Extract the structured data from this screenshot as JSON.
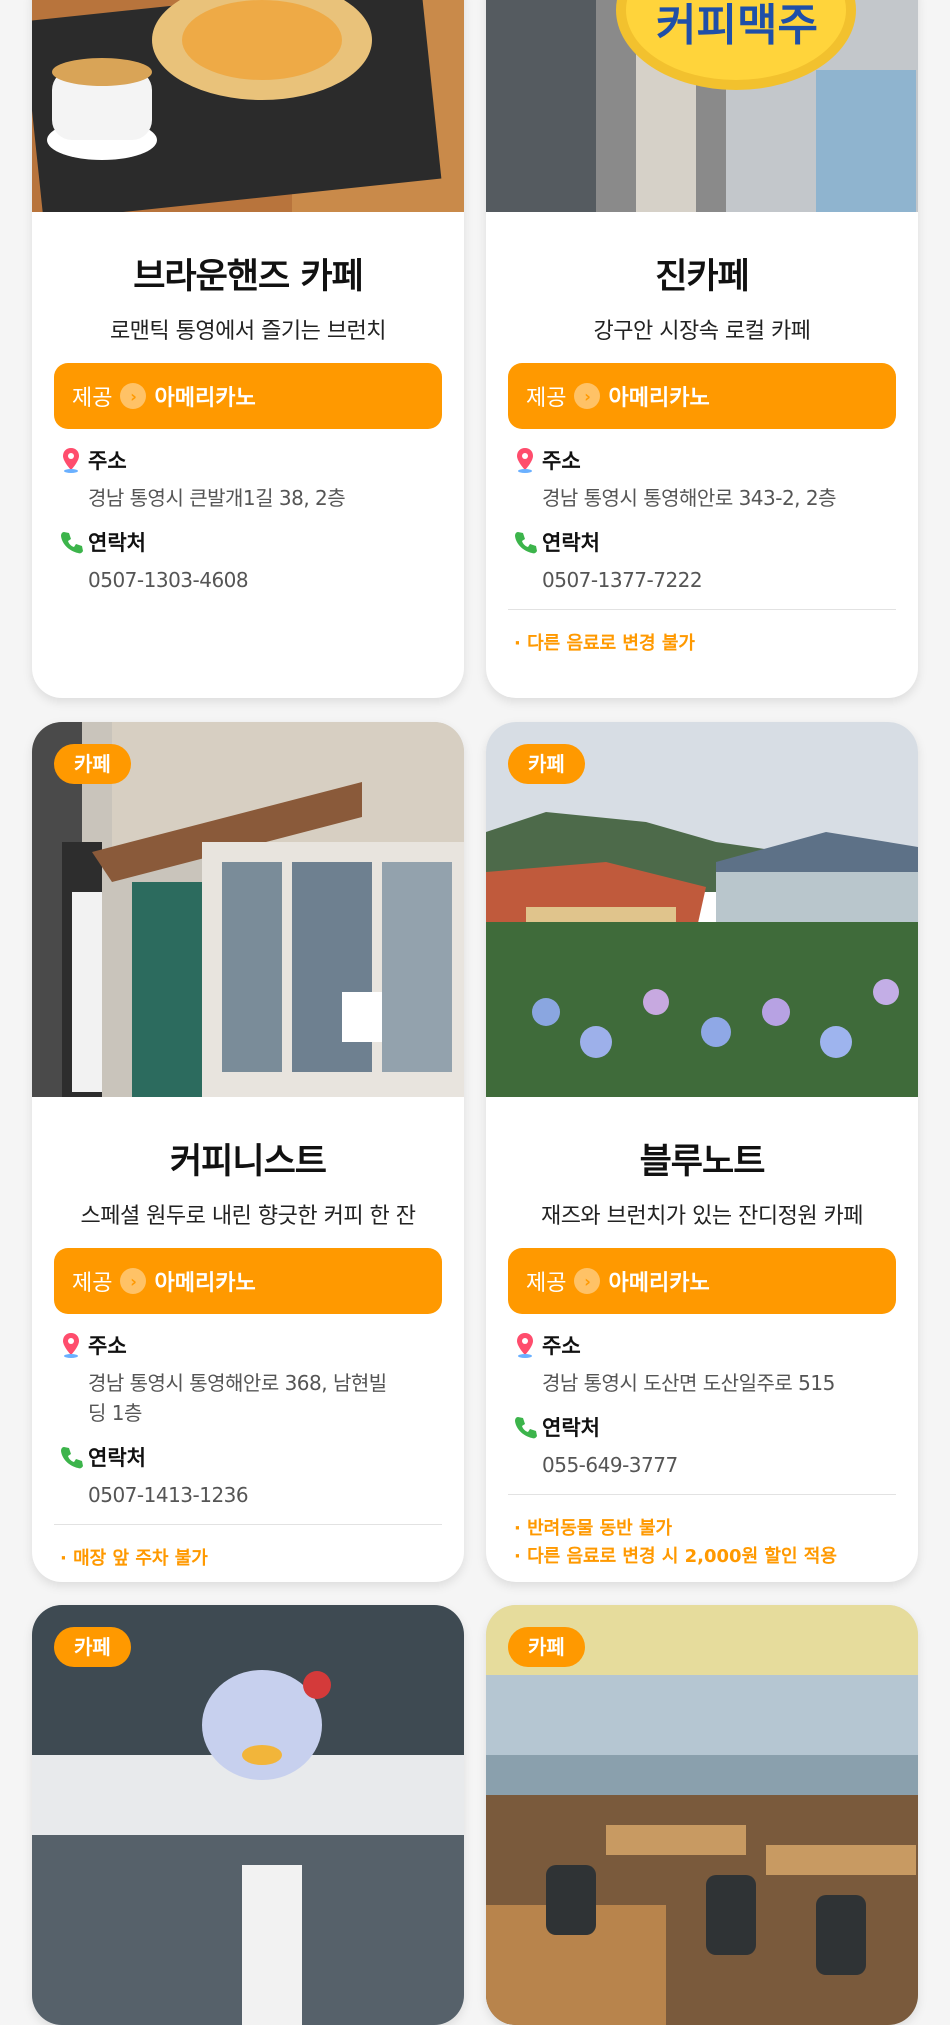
{
  "cards": [
    {
      "name": "브라운핸즈 카페",
      "subtitle": "로맨틱 통영에서 즐기는 브런치",
      "provide_label": "제공",
      "provide_item": "아메리카노",
      "address_label": "주소",
      "address": "경남 통영시 큰발개1길 38, 2층",
      "contact_label": "연락처",
      "contact": "0507-1303-4608",
      "notes": []
    },
    {
      "name": "진카페",
      "subtitle": "강구안 시장속 로컬 카페",
      "provide_label": "제공",
      "provide_item": "아메리카노",
      "address_label": "주소",
      "address": "경남 통영시 통영해안로 343-2, 2층",
      "contact_label": "연락처",
      "contact": "0507-1377-7222",
      "notes": [
        "· 다른 음료로 변경 불가"
      ],
      "sign_text": "커피맥주"
    },
    {
      "badge": "카페",
      "name": "커피니스트",
      "subtitle": "스페셜 원두로 내린 향긋한 커피 한 잔",
      "provide_label": "제공",
      "provide_item": "아메리카노",
      "address_label": "주소",
      "address": "경남 통영시 통영해안로 368, 남현빌딩 1층",
      "contact_label": "연락처",
      "contact": "0507-1413-1236",
      "notes": [
        "· 매장 앞 주차 불가"
      ]
    },
    {
      "badge": "카페",
      "name": "블루노트",
      "subtitle": "재즈와 브런치가 있는 잔디정원 카페",
      "provide_label": "제공",
      "provide_item": "아메리카노",
      "address_label": "주소",
      "address": "경남 통영시 도산면 도산일주로 515",
      "contact_label": "연락처",
      "contact": "055-649-3777",
      "notes": [
        "· 반려동물 동반 불가",
        "· 다른 음료로 변경 시 2,000원 할인 적용"
      ]
    },
    {
      "badge": "카페"
    },
    {
      "badge": "카페"
    }
  ],
  "icons": {
    "address": "location-pin-icon",
    "contact": "phone-icon",
    "provide": "chevron-right-icon"
  },
  "colors": {
    "accent": "#ff9900",
    "note": "#ff9900",
    "pin": "#ff4d6d",
    "phone": "#3cb44b"
  }
}
